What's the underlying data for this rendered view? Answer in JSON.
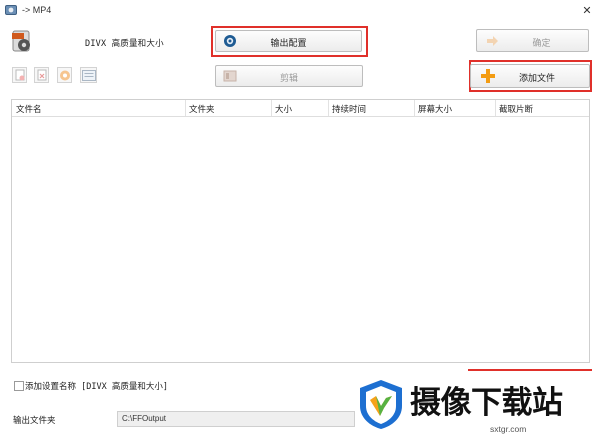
{
  "window": {
    "title": "-> MP4",
    "close_glyph": "✕"
  },
  "profile": {
    "label": "DIVX 高质量和大小"
  },
  "buttons": {
    "output_config": "输出配置",
    "ok": "确定",
    "clip": "剪辑",
    "add_file": "添加文件"
  },
  "table": {
    "columns": [
      "文件名",
      "文件夹",
      "大小",
      "持续时间",
      "屏幕大小",
      "截取片断"
    ]
  },
  "options": {
    "add_profile_name": "添加设置名称 [DIVX 高质量和大小]"
  },
  "output": {
    "folder_label": "输出文件夹",
    "folder_value": "C:\\FFOutput"
  },
  "watermark": {
    "brand": "摄像下载站",
    "url": "sxtgr.com"
  },
  "colors": {
    "highlight": "#e0302a",
    "add_plus": "#f39c12"
  },
  "icons": [
    "app-icon",
    "close-icon",
    "divx-format-icon",
    "output-config-icon",
    "ok-icon",
    "clip-icon",
    "add-plus-icon",
    "remove-file-icon",
    "clear-list-icon",
    "play-icon",
    "info-icon",
    "brand-logo-icon"
  ]
}
